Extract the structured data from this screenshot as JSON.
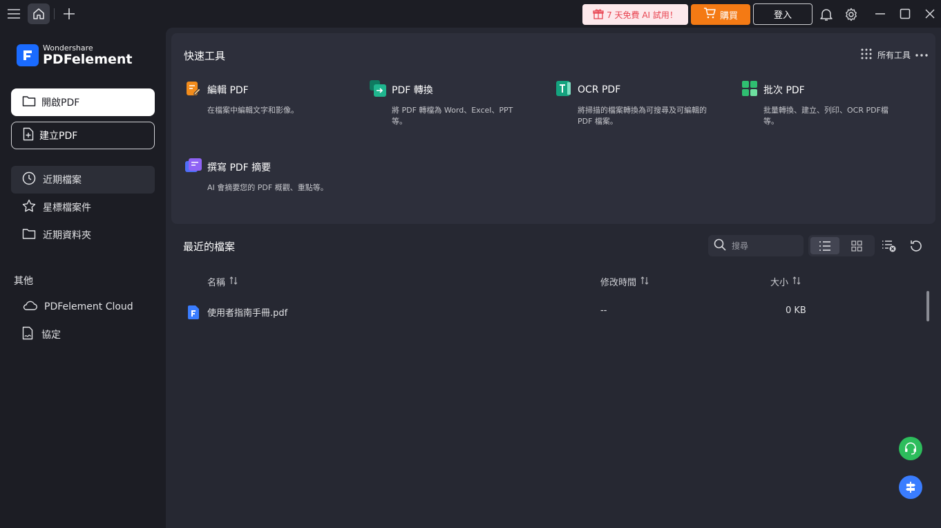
{
  "titlebar": {
    "promo_label": "7 天免費 AI 試用！",
    "buy_label": "購買",
    "login_label": "登入"
  },
  "logo": {
    "brand": "Wondershare",
    "product": "PDFelement"
  },
  "sidebar": {
    "open_label": "開啟PDF",
    "create_label": "建立PDF",
    "nav": [
      {
        "label": "近期檔案",
        "icon": "clock-icon"
      },
      {
        "label": "星標檔案件",
        "icon": "star-icon"
      },
      {
        "label": "近期資料夾",
        "icon": "folder-icon"
      }
    ],
    "other_title": "其他",
    "other": [
      {
        "label": "PDFelement Cloud",
        "icon": "cloud-icon"
      },
      {
        "label": "協定",
        "icon": "agreement-icon"
      }
    ]
  },
  "quick_tools": {
    "title": "快速工具",
    "all_tools_label": "所有工具",
    "tools": [
      {
        "name": "編輯 PDF",
        "desc": "在檔案中編輯文字和影像。",
        "icon": "edit-pdf-icon",
        "color": "#f28c1c"
      },
      {
        "name": "PDF 轉換",
        "desc": "將 PDF 轉檔為 Word、Excel、PPT 等。",
        "icon": "convert-pdf-icon",
        "color": "#1fb58e"
      },
      {
        "name": "OCR PDF",
        "desc": "將掃描的檔案轉換為可搜尋及可編輯的 PDF 檔案。",
        "icon": "ocr-pdf-icon",
        "color": "#14a37f"
      },
      {
        "name": "批次 PDF",
        "desc": "批量轉換、建立、列印、OCR PDF檔等。",
        "icon": "batch-pdf-icon",
        "color": "#2fbf71"
      },
      {
        "name": "撰寫 PDF 摘要",
        "desc": "AI 會摘要您的 PDF 概觀、重點等。",
        "icon": "summarize-pdf-icon",
        "color": "#7a5cf5"
      }
    ]
  },
  "recent": {
    "title": "最近的檔案",
    "search_placeholder": "搜尋",
    "columns": {
      "name": "名稱",
      "modified": "修改時間",
      "size": "大小"
    },
    "rows": [
      {
        "name": "使用者指南手冊.pdf",
        "modified": "--",
        "size": "0 KB"
      }
    ]
  },
  "colors": {
    "accent": "#1a6bff",
    "buy": "#f47a14",
    "support": "#2dbd5c",
    "guide": "#3a7dff"
  }
}
